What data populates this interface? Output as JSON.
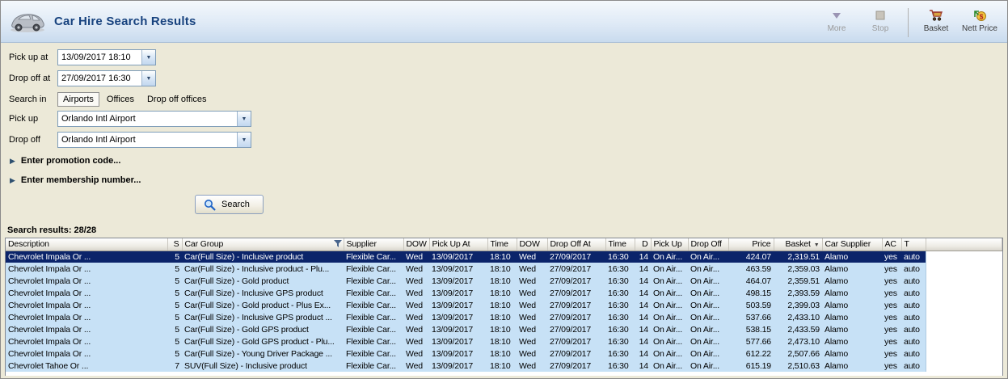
{
  "colors": {
    "title_color": "#17427E",
    "selected_row_bg": "#0B246A",
    "row_bg": "#C7E1F6"
  },
  "header": {
    "title": "Car Hire Search Results",
    "toolbar": {
      "more": {
        "label": "More",
        "disabled": true
      },
      "stop": {
        "label": "Stop",
        "disabled": true
      },
      "basket": {
        "label": "Basket",
        "disabled": false
      },
      "nett_price": {
        "label": "Nett Price",
        "disabled": false
      }
    }
  },
  "form": {
    "pickup_at": {
      "label": "Pick up at",
      "value": "13/09/2017 18:10"
    },
    "dropoff_at": {
      "label": "Drop off at",
      "value": "27/09/2017 16:30"
    },
    "search_in": {
      "label": "Search in",
      "tabs": [
        "Airports",
        "Offices",
        "Drop off offices"
      ],
      "selected": "Airports"
    },
    "pickup": {
      "label": "Pick up",
      "value": "Orlando Intl Airport"
    },
    "dropoff": {
      "label": "Drop off",
      "value": "Orlando Intl Airport"
    },
    "promotion_label": "Enter promotion code...",
    "membership_label": "Enter membership number...",
    "search_button_label": "Search"
  },
  "results_table": {
    "summary": "Search results: 28/28",
    "selected_row": 0,
    "columns": [
      {
        "label": "Description",
        "align": "left"
      },
      {
        "label": "S",
        "align": "right"
      },
      {
        "label": "Car Group",
        "align": "left",
        "filter_icon": true
      },
      {
        "label": "Supplier",
        "align": "left"
      },
      {
        "label": "DOW",
        "align": "left"
      },
      {
        "label": "Pick Up At",
        "align": "left"
      },
      {
        "label": "Time",
        "align": "left"
      },
      {
        "label": "DOW",
        "align": "left"
      },
      {
        "label": "Drop Off At",
        "align": "left"
      },
      {
        "label": "Time",
        "align": "left"
      },
      {
        "label": "D",
        "align": "right"
      },
      {
        "label": "Pick Up",
        "align": "left"
      },
      {
        "label": "Drop Off",
        "align": "left"
      },
      {
        "label": "Price",
        "align": "right"
      },
      {
        "label": "Basket",
        "align": "right",
        "sort_icon": true
      },
      {
        "label": "Car Supplier",
        "align": "left"
      },
      {
        "label": "AC",
        "align": "left"
      },
      {
        "label": "T",
        "align": "left"
      }
    ],
    "rows": [
      [
        "Chevrolet Impala Or ...",
        "5",
        "Car(Full Size) - Inclusive product",
        "Flexible Car...",
        "Wed",
        "13/09/2017",
        "18:10",
        "Wed",
        "27/09/2017",
        "16:30",
        "14",
        "On Air...",
        "On Air...",
        "424.07",
        "2,319.51",
        "Alamo",
        "yes",
        "auto"
      ],
      [
        "Chevrolet Impala Or ...",
        "5",
        "Car(Full Size) - Inclusive product - Plu...",
        "Flexible Car...",
        "Wed",
        "13/09/2017",
        "18:10",
        "Wed",
        "27/09/2017",
        "16:30",
        "14",
        "On Air...",
        "On Air...",
        "463.59",
        "2,359.03",
        "Alamo",
        "yes",
        "auto"
      ],
      [
        "Chevrolet Impala Or ...",
        "5",
        "Car(Full Size) - Gold product",
        "Flexible Car...",
        "Wed",
        "13/09/2017",
        "18:10",
        "Wed",
        "27/09/2017",
        "16:30",
        "14",
        "On Air...",
        "On Air...",
        "464.07",
        "2,359.51",
        "Alamo",
        "yes",
        "auto"
      ],
      [
        "Chevrolet Impala Or ...",
        "5",
        "Car(Full Size) - Inclusive GPS product",
        "Flexible Car...",
        "Wed",
        "13/09/2017",
        "18:10",
        "Wed",
        "27/09/2017",
        "16:30",
        "14",
        "On Air...",
        "On Air...",
        "498.15",
        "2,393.59",
        "Alamo",
        "yes",
        "auto"
      ],
      [
        "Chevrolet Impala Or ...",
        "5",
        "Car(Full Size) - Gold product - Plus Ex...",
        "Flexible Car...",
        "Wed",
        "13/09/2017",
        "18:10",
        "Wed",
        "27/09/2017",
        "16:30",
        "14",
        "On Air...",
        "On Air...",
        "503.59",
        "2,399.03",
        "Alamo",
        "yes",
        "auto"
      ],
      [
        "Chevrolet Impala Or ...",
        "5",
        "Car(Full Size) - Inclusive GPS product ...",
        "Flexible Car...",
        "Wed",
        "13/09/2017",
        "18:10",
        "Wed",
        "27/09/2017",
        "16:30",
        "14",
        "On Air...",
        "On Air...",
        "537.66",
        "2,433.10",
        "Alamo",
        "yes",
        "auto"
      ],
      [
        "Chevrolet Impala Or ...",
        "5",
        "Car(Full Size) - Gold GPS product",
        "Flexible Car...",
        "Wed",
        "13/09/2017",
        "18:10",
        "Wed",
        "27/09/2017",
        "16:30",
        "14",
        "On Air...",
        "On Air...",
        "538.15",
        "2,433.59",
        "Alamo",
        "yes",
        "auto"
      ],
      [
        "Chevrolet Impala Or ...",
        "5",
        "Car(Full Size) - Gold GPS product - Plu...",
        "Flexible Car...",
        "Wed",
        "13/09/2017",
        "18:10",
        "Wed",
        "27/09/2017",
        "16:30",
        "14",
        "On Air...",
        "On Air...",
        "577.66",
        "2,473.10",
        "Alamo",
        "yes",
        "auto"
      ],
      [
        "Chevrolet Impala Or ...",
        "5",
        "Car(Full Size) - Young Driver Package ...",
        "Flexible Car...",
        "Wed",
        "13/09/2017",
        "18:10",
        "Wed",
        "27/09/2017",
        "16:30",
        "14",
        "On Air...",
        "On Air...",
        "612.22",
        "2,507.66",
        "Alamo",
        "yes",
        "auto"
      ],
      [
        "Chevrolet Tahoe Or ...",
        "7",
        "SUV(Full Size) - Inclusive product",
        "Flexible Car...",
        "Wed",
        "13/09/2017",
        "18:10",
        "Wed",
        "27/09/2017",
        "16:30",
        "14",
        "On Air...",
        "On Air...",
        "615.19",
        "2,510.63",
        "Alamo",
        "yes",
        "auto"
      ]
    ]
  }
}
